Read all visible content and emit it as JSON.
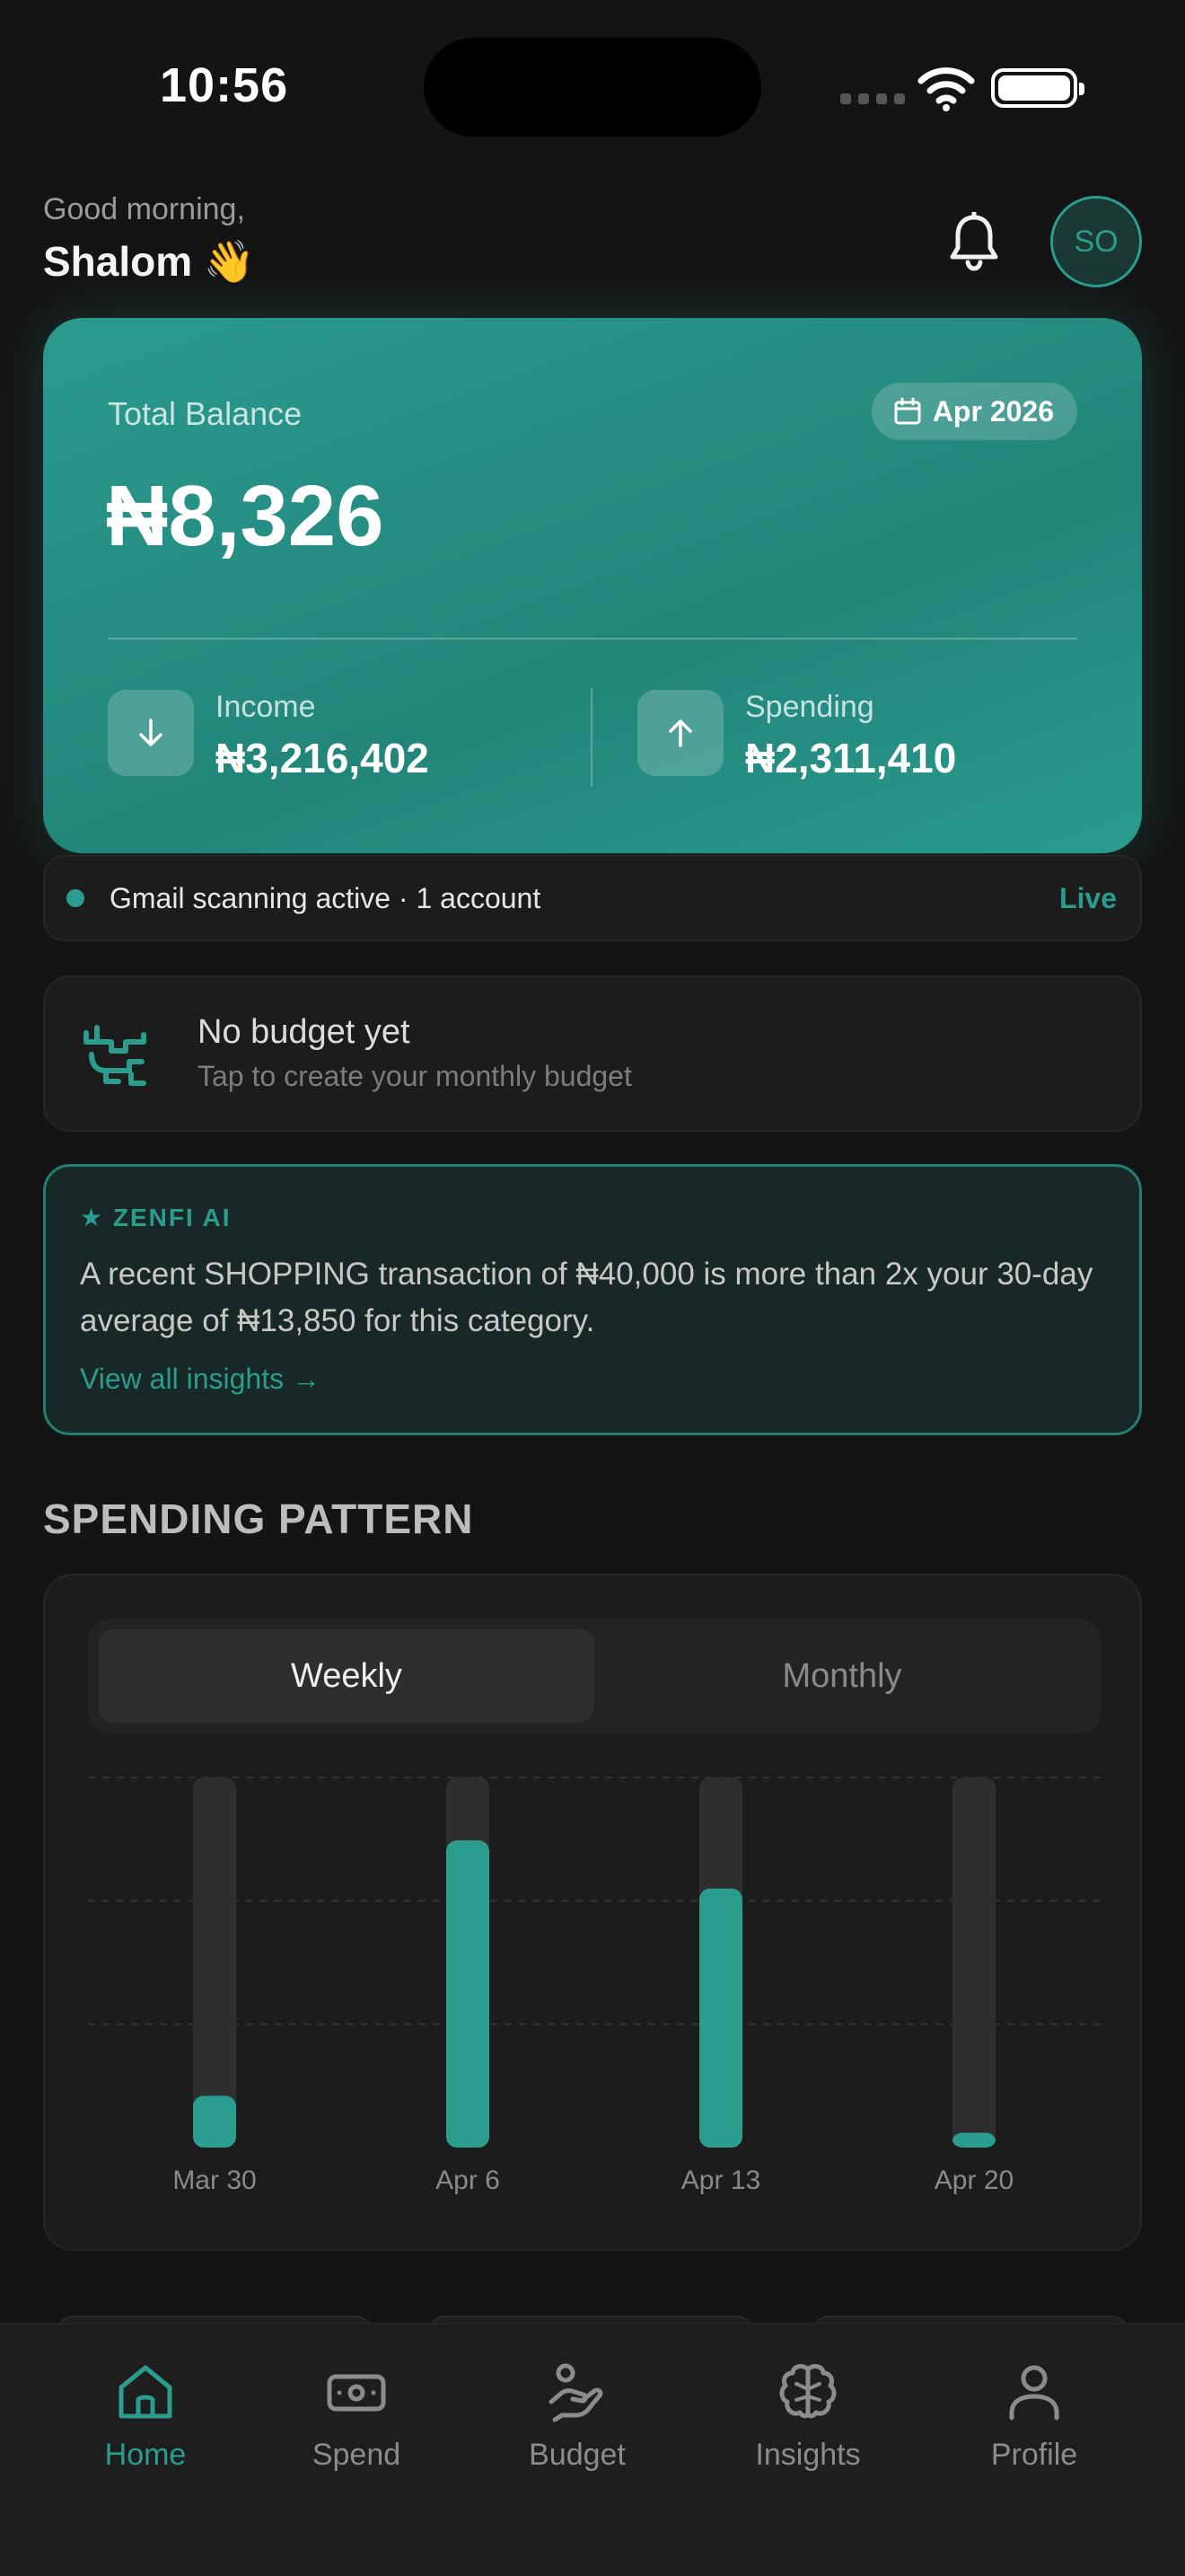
{
  "status_bar": {
    "time": "10:56"
  },
  "header": {
    "greeting": "Good morning,",
    "name": "Shalom 👋",
    "avatar_initials": "SO"
  },
  "balance_card": {
    "label": "Total Balance",
    "period": "Apr 2026",
    "amount": "₦8,326",
    "income": {
      "label": "Income",
      "value": "₦3,216,402"
    },
    "spending": {
      "label": "Spending",
      "value": "₦2,311,410"
    }
  },
  "gmail": {
    "text": "Gmail scanning active · 1 account",
    "status": "Live"
  },
  "budget": {
    "title": "No budget yet",
    "subtitle": "Tap to create your monthly budget"
  },
  "ai_insight": {
    "tag": "★ ZENFI AI",
    "text": "A recent SHOPPING transaction of ₦40,000 is more than 2x your 30-day average of ₦13,850 for this category.",
    "link": "View all insights →"
  },
  "spending_pattern": {
    "title": "SPENDING PATTERN",
    "tabs": {
      "weekly": "Weekly",
      "monthly": "Monthly"
    },
    "selected_tab": "Weekly"
  },
  "chart_data": {
    "type": "bar",
    "categories": [
      "Mar 30",
      "Apr 6",
      "Apr 13",
      "Apr 20"
    ],
    "values": [
      0.14,
      0.83,
      0.7,
      0.04
    ],
    "ylim": [
      0,
      1
    ],
    "grid": true,
    "accent": "#2a9d8f",
    "track": "#2e2e2e"
  },
  "nav": {
    "items": [
      {
        "label": "Home",
        "icon": "home-icon",
        "active": true
      },
      {
        "label": "Spend",
        "icon": "cash-icon",
        "active": false
      },
      {
        "label": "Budget",
        "icon": "hand-coin-icon",
        "active": false
      },
      {
        "label": "Insights",
        "icon": "brain-icon",
        "active": false
      },
      {
        "label": "Profile",
        "icon": "user-icon",
        "active": false
      }
    ]
  },
  "colors": {
    "accent": "#2a9d8f",
    "background": "#141414",
    "card": "#1c1c1c"
  }
}
